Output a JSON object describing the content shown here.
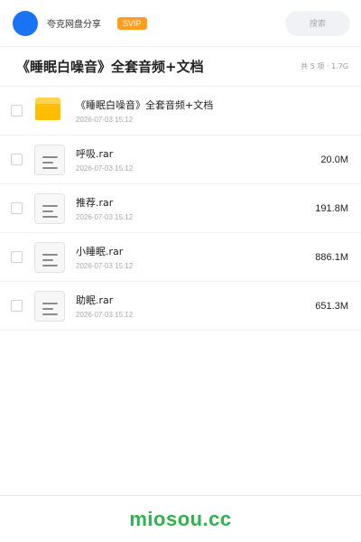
{
  "header": {
    "share_name": "夸克网盘分享",
    "badge": "SVIP",
    "search_placeholder": "搜索",
    "avatar_color": "#1a73f5",
    "badge_color": "#ff9e1f"
  },
  "folder": {
    "title": "《睡眠白噪音》全套音频+文档",
    "summary": "共 5 项 · 1.7G"
  },
  "files": [
    {
      "name": "《睡眠白噪音》全套音频+文档",
      "date": "2026-07-03 15:12",
      "size": "",
      "icon": "folder-icon"
    },
    {
      "name": "呼吸.rar",
      "date": "2026-07-03 15:12",
      "size": "20.0M",
      "icon": "archive-file-icon"
    },
    {
      "name": "推荐.rar",
      "date": "2026-07-03 15:12",
      "size": "191.8M",
      "icon": "archive-file-icon"
    },
    {
      "name": "小睡眠.rar",
      "date": "2026-07-03 15:12",
      "size": "886.1M",
      "icon": "archive-file-icon"
    },
    {
      "name": "助眠.rar",
      "date": "2026-07-03 15:12",
      "size": "651.3M",
      "icon": "archive-file-icon"
    }
  ],
  "footer": {
    "watermark": "miosou.cc",
    "watermark_color": "#2eb34d"
  }
}
